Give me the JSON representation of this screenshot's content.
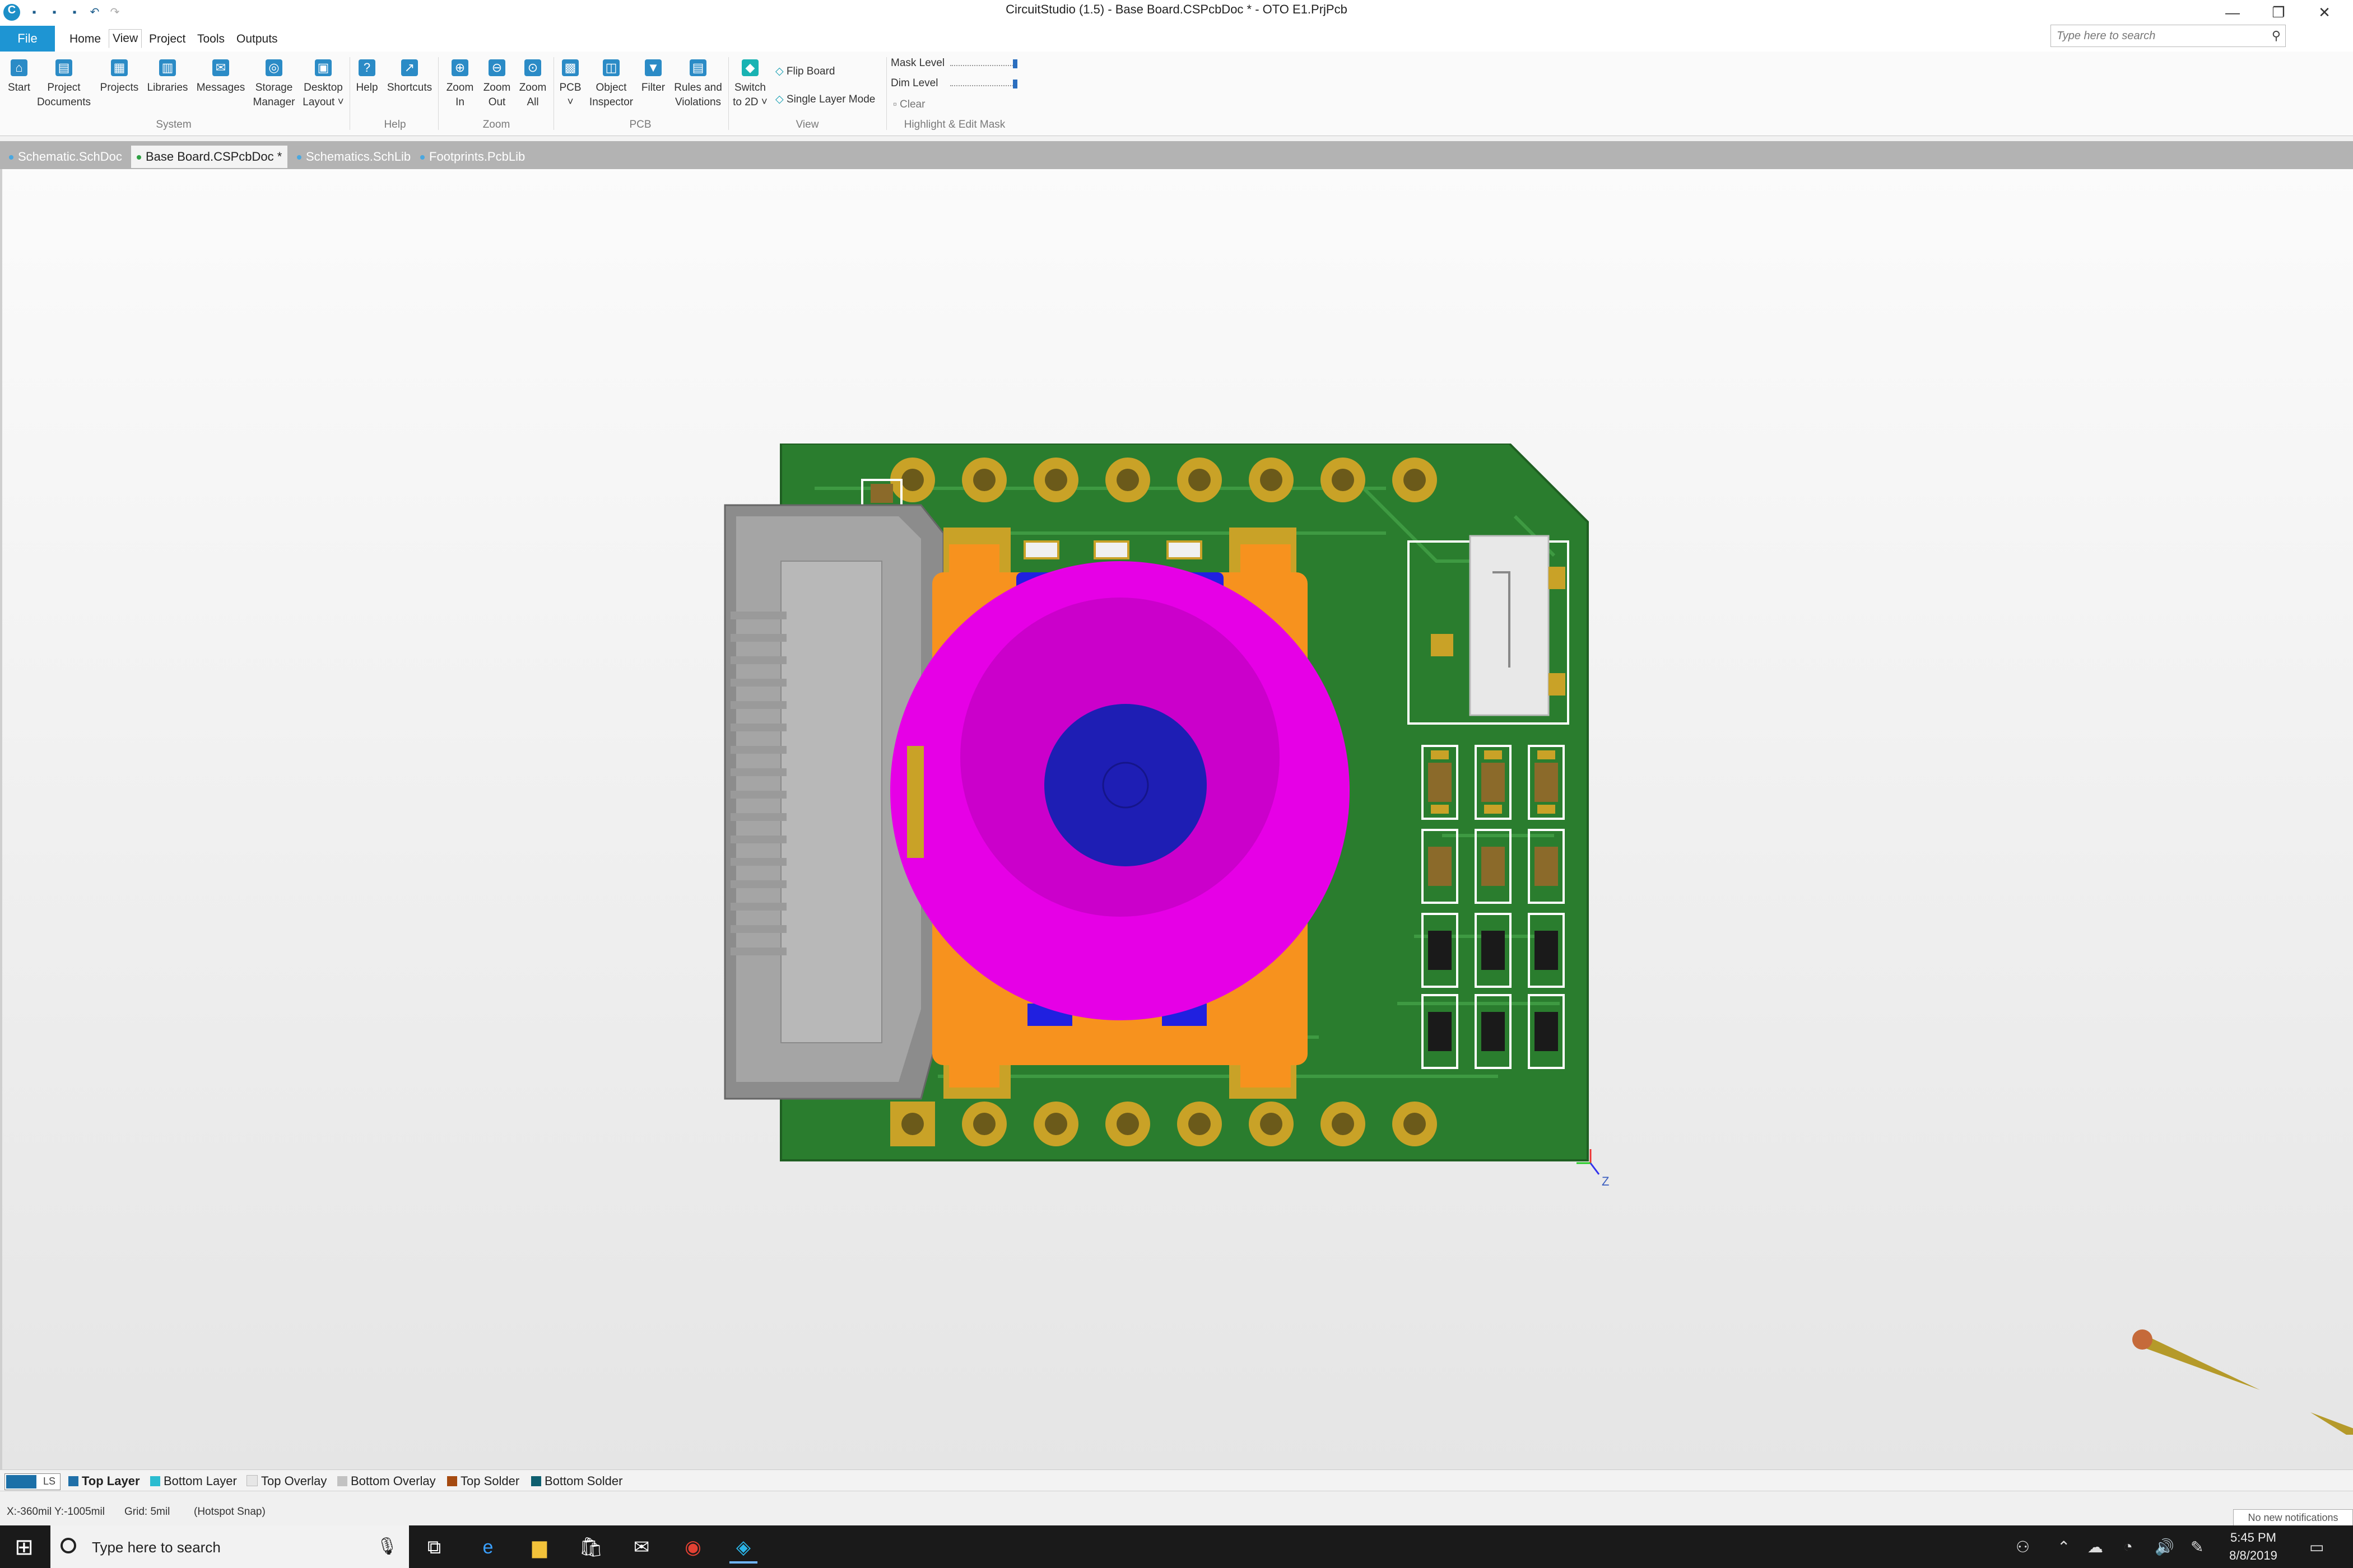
{
  "window": {
    "title": "CircuitStudio (1.5) - Base Board.CSPcbDoc * - OTO E1.PrjPcb",
    "minimize": "—",
    "restore": "❐",
    "close": "✕"
  },
  "search": {
    "placeholder": "Type here to search",
    "icon": "search-icon"
  },
  "menu": [
    "File",
    "Home",
    "View",
    "Project",
    "Tools",
    "Outputs"
  ],
  "ribbon": {
    "system": {
      "group": "System",
      "buttons": [
        {
          "icon": "home-icon",
          "label": "Start"
        },
        {
          "icon": "project-documents-icon",
          "label": "Project",
          "label2": "Documents"
        },
        {
          "icon": "projects-icon",
          "label": "Projects"
        },
        {
          "icon": "libraries-icon",
          "label": "Libraries"
        },
        {
          "icon": "messages-icon",
          "label": "Messages"
        },
        {
          "icon": "storage-manager-icon",
          "label": "Storage",
          "label2": "Manager"
        },
        {
          "icon": "desktop-layout-icon",
          "label": "Desktop",
          "label2": "Layout ˅"
        }
      ]
    },
    "help": {
      "group": "Help",
      "buttons": [
        {
          "icon": "help-icon",
          "label": "Help"
        },
        {
          "icon": "shortcuts-icon",
          "label": "Shortcuts"
        }
      ]
    },
    "zoom": {
      "group": "Zoom",
      "buttons": [
        {
          "icon": "zoom-in-icon",
          "label": "Zoom",
          "label2": "In"
        },
        {
          "icon": "zoom-out-icon",
          "label": "Zoom",
          "label2": "Out"
        },
        {
          "icon": "zoom-all-icon",
          "label": "Zoom",
          "label2": "All"
        }
      ]
    },
    "pcb": {
      "group": "PCB",
      "buttons": [
        {
          "icon": "pcb-icon",
          "label": "PCB",
          "label2": "˅"
        },
        {
          "icon": "object-inspector-icon",
          "label": "Object",
          "label2": "Inspector"
        },
        {
          "icon": "filter-icon",
          "label": "Filter"
        },
        {
          "icon": "rules-violations-icon",
          "label": "Rules and",
          "label2": "Violations"
        }
      ]
    },
    "view": {
      "group": "View",
      "switch_label": "Switch",
      "switch_label2": "to 2D ˅",
      "flip_board": "Flip Board",
      "single_layer_mode": "Single Layer Mode"
    },
    "mask": {
      "group": "Highlight & Edit Mask",
      "mask_level": "Mask Level",
      "dim_level": "Dim Level",
      "clear": "Clear"
    }
  },
  "doc_tabs": [
    {
      "label": "Schematic.SchDoc",
      "active": false
    },
    {
      "label": "Base Board.CSPcbDoc *",
      "active": true
    },
    {
      "label": "Schematics.SchLib",
      "active": false
    },
    {
      "label": "Footprints.PcbLib",
      "active": false
    }
  ],
  "pcb": {
    "axis_label": "Z",
    "colors": {
      "board": "#2a7d2e",
      "pad": "#c9a227",
      "connector": "#9a9a9a",
      "component_body": "#f7921e",
      "knob": "#e600e6",
      "knob_center": "#1e1eb4",
      "blue_part": "#2020e0"
    }
  },
  "layers": {
    "ls_label": "LS",
    "tabs": [
      {
        "label": "Top Layer",
        "color": "#1f6fa8",
        "active": true
      },
      {
        "label": "Bottom Layer",
        "color": "#2bbcd0",
        "active": false
      },
      {
        "label": "Top Overlay",
        "color": "#e6e6e6",
        "active": false
      },
      {
        "label": "Bottom Overlay",
        "color": "#c2c2c2",
        "active": false
      },
      {
        "label": "Top Solder",
        "color": "#a54a10",
        "active": false
      },
      {
        "label": "Bottom Solder",
        "color": "#0e5f6f",
        "active": false
      }
    ]
  },
  "status": {
    "coords": "X:-360mil Y:-1005mil",
    "grid": "Grid: 5mil",
    "snap": "(Hotspot Snap)",
    "notifications": "No new notifications"
  },
  "taskbar": {
    "search_placeholder": "Type here to search",
    "time": "5:45 PM",
    "date": "8/8/2019"
  }
}
